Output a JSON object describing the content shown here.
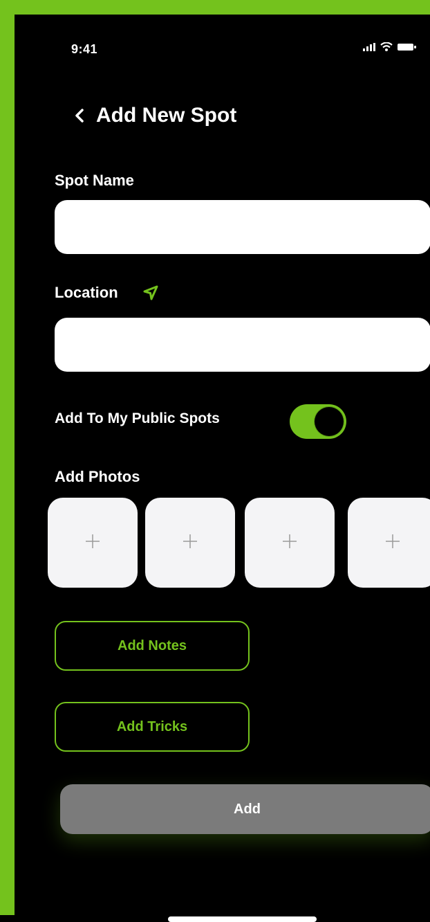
{
  "status_bar": {
    "time": "9:41"
  },
  "header": {
    "title": "Add New Spot"
  },
  "form": {
    "spot_name": {
      "label": "Spot  Name",
      "value": "",
      "placeholder": ""
    },
    "location": {
      "label": "Location",
      "value": "",
      "placeholder": ""
    },
    "public_toggle": {
      "label": "Add To My Public Spots",
      "on": true
    },
    "photos": {
      "label": "Add Photos",
      "slots": [
        "+",
        "+",
        "+",
        "+"
      ]
    }
  },
  "buttons": {
    "add_notes": "Add Notes",
    "add_tricks": "Add Tricks",
    "add": "Add"
  },
  "colors": {
    "accent": "#74c21d",
    "background": "#000000",
    "input_bg": "#ffffff",
    "photo_slot_bg": "#f4f4f6",
    "add_button_bg": "#7b7b7b"
  },
  "icons": [
    "signal-icon",
    "wifi-icon",
    "battery-icon",
    "back-chevron-icon",
    "location-arrow-icon",
    "plus-icon"
  ]
}
